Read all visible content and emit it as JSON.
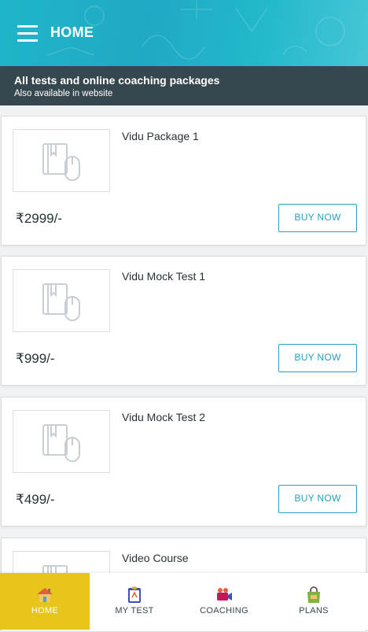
{
  "header": {
    "title": "HOME"
  },
  "banner": {
    "title": "All tests and online coaching packages",
    "subtitle": "Also available in website"
  },
  "packages": [
    {
      "name": "Vidu Package 1",
      "price": "₹2999/-",
      "button": "BUY NOW"
    },
    {
      "name": "Vidu Mock Test 1",
      "price": "₹999/-",
      "button": "BUY NOW"
    },
    {
      "name": "Vidu Mock Test 2",
      "price": "₹499/-",
      "button": "BUY NOW"
    },
    {
      "name": "Video Course"
    }
  ],
  "bottom_nav": {
    "items": [
      {
        "label": "HOME",
        "icon": "home-icon",
        "active": true
      },
      {
        "label": "MY TEST",
        "icon": "clipboard-icon",
        "active": false
      },
      {
        "label": "COACHING",
        "icon": "video-camera-icon",
        "active": false
      },
      {
        "label": "PLANS",
        "icon": "shopping-bag-icon",
        "active": false
      }
    ]
  },
  "colors": {
    "accent": "#2a9fc0",
    "header": "#1fb5c9",
    "banner": "#37474f",
    "active_tab": "#e8c51b"
  }
}
